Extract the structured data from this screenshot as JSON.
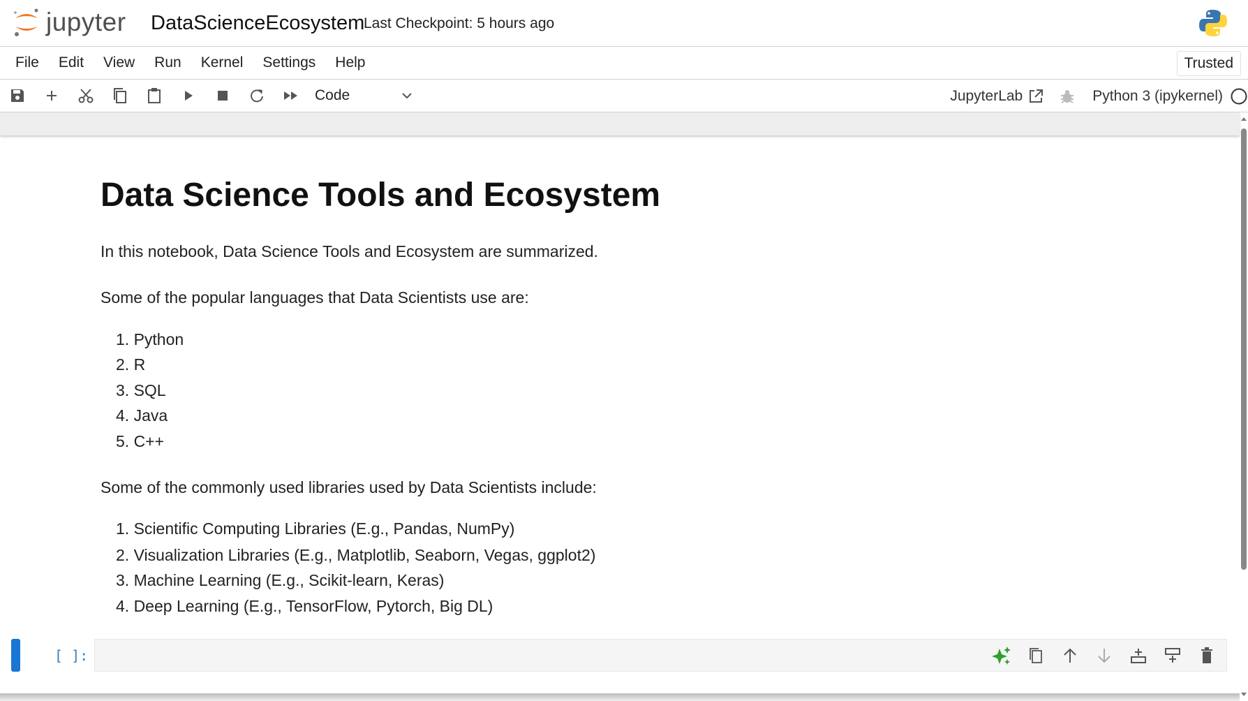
{
  "header": {
    "logo_text": "jupyter",
    "notebook_title": "DataScienceEcosystem",
    "checkpoint": "Last Checkpoint: 5 hours ago"
  },
  "menu": {
    "items": [
      "File",
      "Edit",
      "View",
      "Run",
      "Kernel",
      "Settings",
      "Help"
    ],
    "trusted": "Trusted"
  },
  "toolbar": {
    "cell_type": "Code",
    "jupyterlab": "JupyterLab",
    "kernel": "Python 3 (ipykernel)"
  },
  "notebook": {
    "heading": "Data Science Tools and Ecosystem",
    "intro": "In this notebook, Data Science Tools and Ecosystem are summarized.",
    "languages_intro": "Some of the popular languages that Data Scientists use are:",
    "languages": [
      "1. Python",
      "2. R",
      "3. SQL",
      "4. Java",
      "5. C++"
    ],
    "libraries_intro": "Some of the commonly used libraries used by Data Scientists include:",
    "libraries": [
      "1. Scientific Computing Libraries (E.g., Pandas, NumPy)",
      "2. Visualization Libraries (E.g., Matplotlib, Seaborn, Vegas, ggplot2)",
      "3. Machine Learning (E.g., Scikit-learn, Keras)",
      "4. Deep Learning (E.g., TensorFlow, Pytorch, Big DL)"
    ],
    "prompt": "[ ]:"
  },
  "colors": {
    "accent": "#1976d2",
    "orange": "#f37626",
    "ai": "#2e9e2e"
  }
}
